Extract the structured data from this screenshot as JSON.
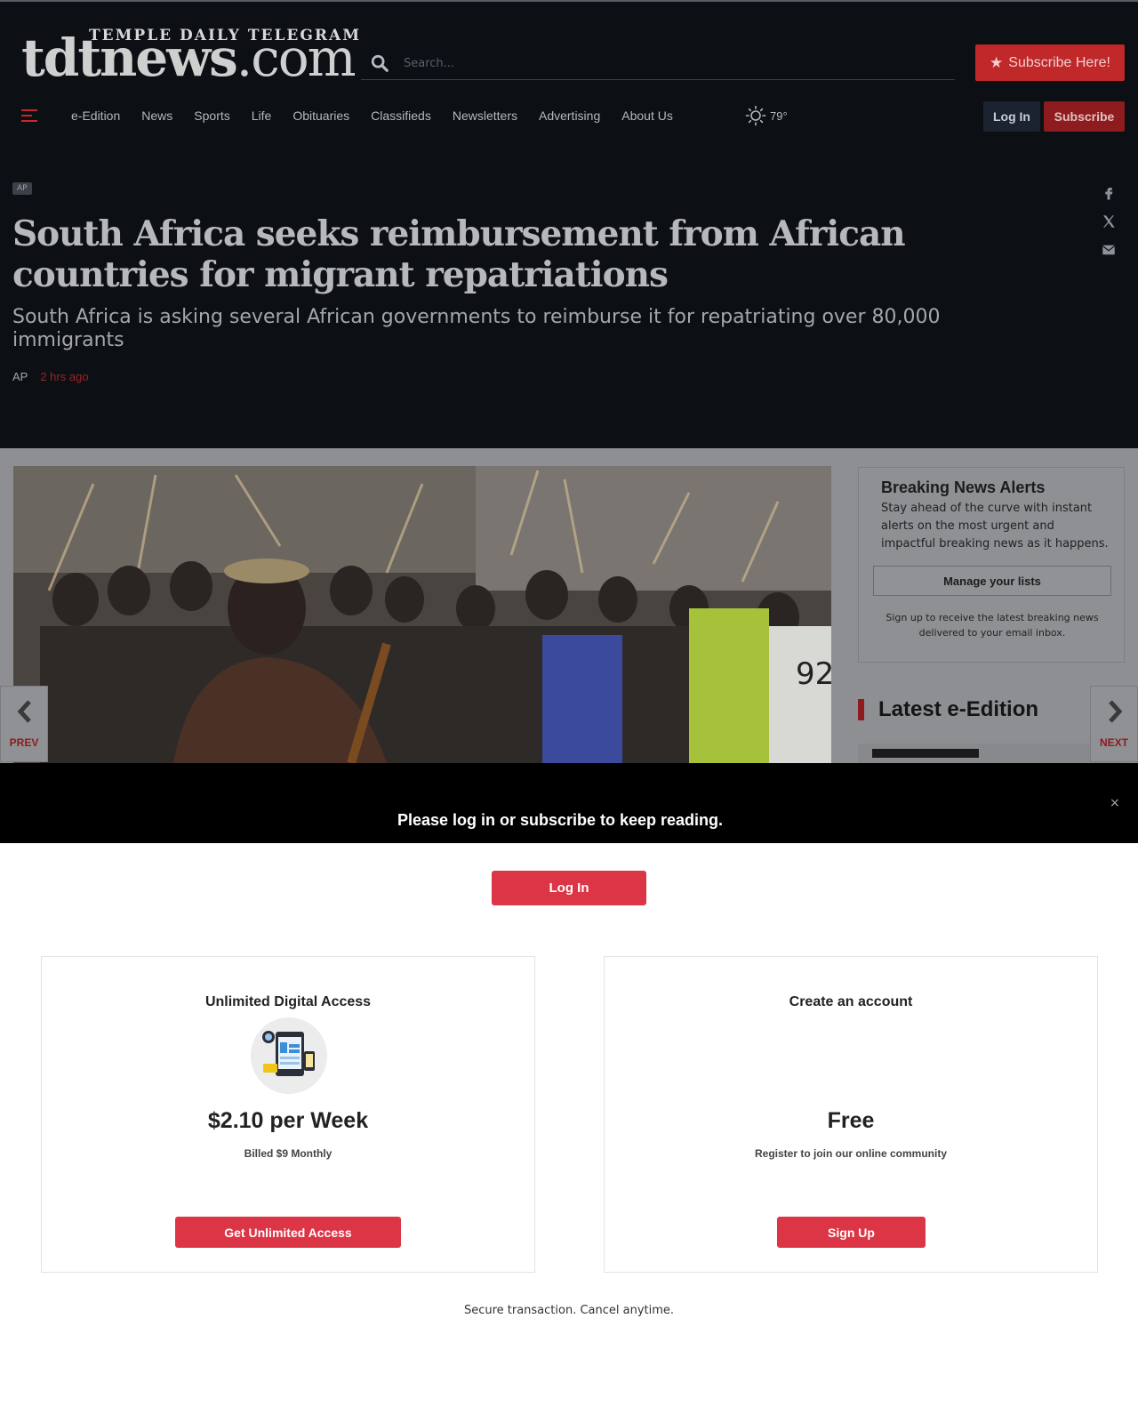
{
  "header": {
    "logo_small": "TEMPLE DAILY TELEGRAM",
    "logo_main": "tdtnews",
    "logo_suffix": ".com",
    "search_placeholder": "Search...",
    "subscribe_here_label": "Subscribe Here!",
    "nav_items": [
      "e-Edition",
      "News",
      "Sports",
      "Life",
      "Obituaries",
      "Classifieds",
      "Newsletters",
      "Advertising",
      "About Us"
    ],
    "weather_temp": "79°",
    "login_label": "Log In",
    "subscribe_label": "Subscribe",
    "accent_color": "#c0282a"
  },
  "article": {
    "tag": "AP",
    "headline": "South Africa seeks reimbursement from African countries for migrant repatriations",
    "subheadline": "South Africa is asking several African governments to reimburse it for repatriating over 80,000 immigrants",
    "byline_author": "AP",
    "byline_time": "2 hrs ago"
  },
  "sidebar": {
    "alerts_title": "Breaking News Alerts",
    "alerts_desc": "Stay ahead of the curve with instant alerts on the most urgent and impactful breaking news as it happens.",
    "manage_label": "Manage your lists",
    "alerts_note": "Sign up to receive the latest breaking news delivered to your email inbox.",
    "latest_title": "Latest e-Edition"
  },
  "nav_arrows": {
    "prev_label": "PREV",
    "next_label": "NEXT"
  },
  "paywall": {
    "message": "Please log in or subscribe to keep reading.",
    "close_symbol": "×",
    "login_label": "Log In",
    "offers": [
      {
        "title": "Unlimited Digital Access",
        "price": "$2.10 per Week",
        "subtitle": "Billed $9 Monthly",
        "button": "Get Unlimited Access"
      },
      {
        "title": "Create an account",
        "price": "Free",
        "subtitle": "Register to join our online community",
        "button": "Sign Up"
      }
    ],
    "footer_note": "Secure transaction. Cancel anytime.",
    "button_color": "#dc3545"
  }
}
